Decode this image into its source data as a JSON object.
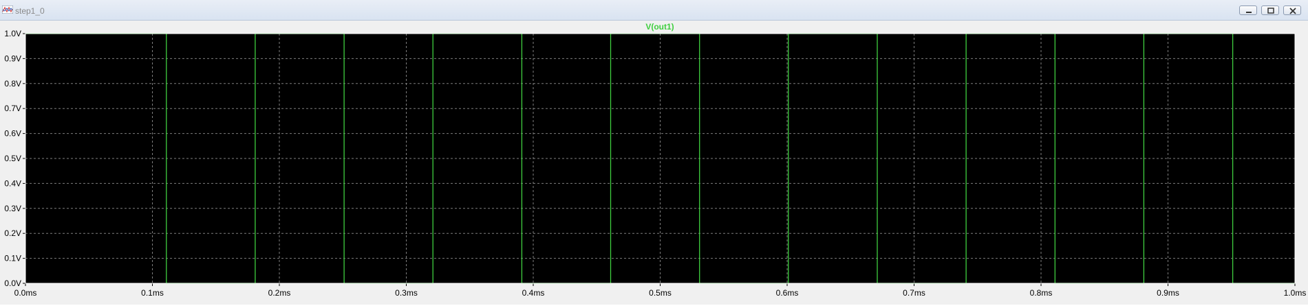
{
  "window": {
    "title": "step1_0",
    "minimize_icon": "minimize-icon",
    "restore_icon": "restore-icon",
    "close_icon": "close-icon"
  },
  "colors": {
    "plot_background": "#000000",
    "trace": "#3fcf3f",
    "grid": "#7f7f7f",
    "frame": "#ffffff",
    "axis_text": "#000000"
  },
  "chart_data": {
    "type": "line",
    "title": "V(out1)",
    "xlabel": "",
    "ylabel": "",
    "xlim": [
      0,
      1.0
    ],
    "ylim": [
      0,
      1.0
    ],
    "x_tick_labels": [
      "0.0ms",
      "0.1ms",
      "0.2ms",
      "0.3ms",
      "0.4ms",
      "0.5ms",
      "0.6ms",
      "0.7ms",
      "0.8ms",
      "0.9ms",
      "1.0ms"
    ],
    "x_ticks": [
      0,
      0.1,
      0.2,
      0.3,
      0.4,
      0.5,
      0.6,
      0.7,
      0.8,
      0.9,
      1.0
    ],
    "y_tick_labels": [
      "0.0V",
      "0.1V",
      "0.2V",
      "0.3V",
      "0.4V",
      "0.5V",
      "0.6V",
      "0.7V",
      "0.8V",
      "0.9V",
      "1.0V"
    ],
    "y_ticks": [
      0,
      0.1,
      0.2,
      0.3,
      0.4,
      0.5,
      0.6,
      0.7,
      0.8,
      0.9,
      1.0
    ],
    "grid": true,
    "series": [
      {
        "name": "V(out1)",
        "x": [
          0,
          0.111,
          0.111,
          0.181,
          0.181,
          0.251,
          0.251,
          0.321,
          0.321,
          0.391,
          0.391,
          0.461,
          0.461,
          0.531,
          0.531,
          0.601,
          0.601,
          0.671,
          0.671,
          0.741,
          0.741,
          0.811,
          0.811,
          0.881,
          0.881,
          0.951,
          0.951,
          1.0
        ],
        "y": [
          1,
          1,
          0,
          0,
          1,
          1,
          0,
          0,
          1,
          1,
          0,
          0,
          1,
          1,
          0,
          0,
          1,
          1,
          0,
          0,
          1,
          1,
          0,
          0,
          1,
          1,
          0,
          0
        ]
      }
    ]
  }
}
